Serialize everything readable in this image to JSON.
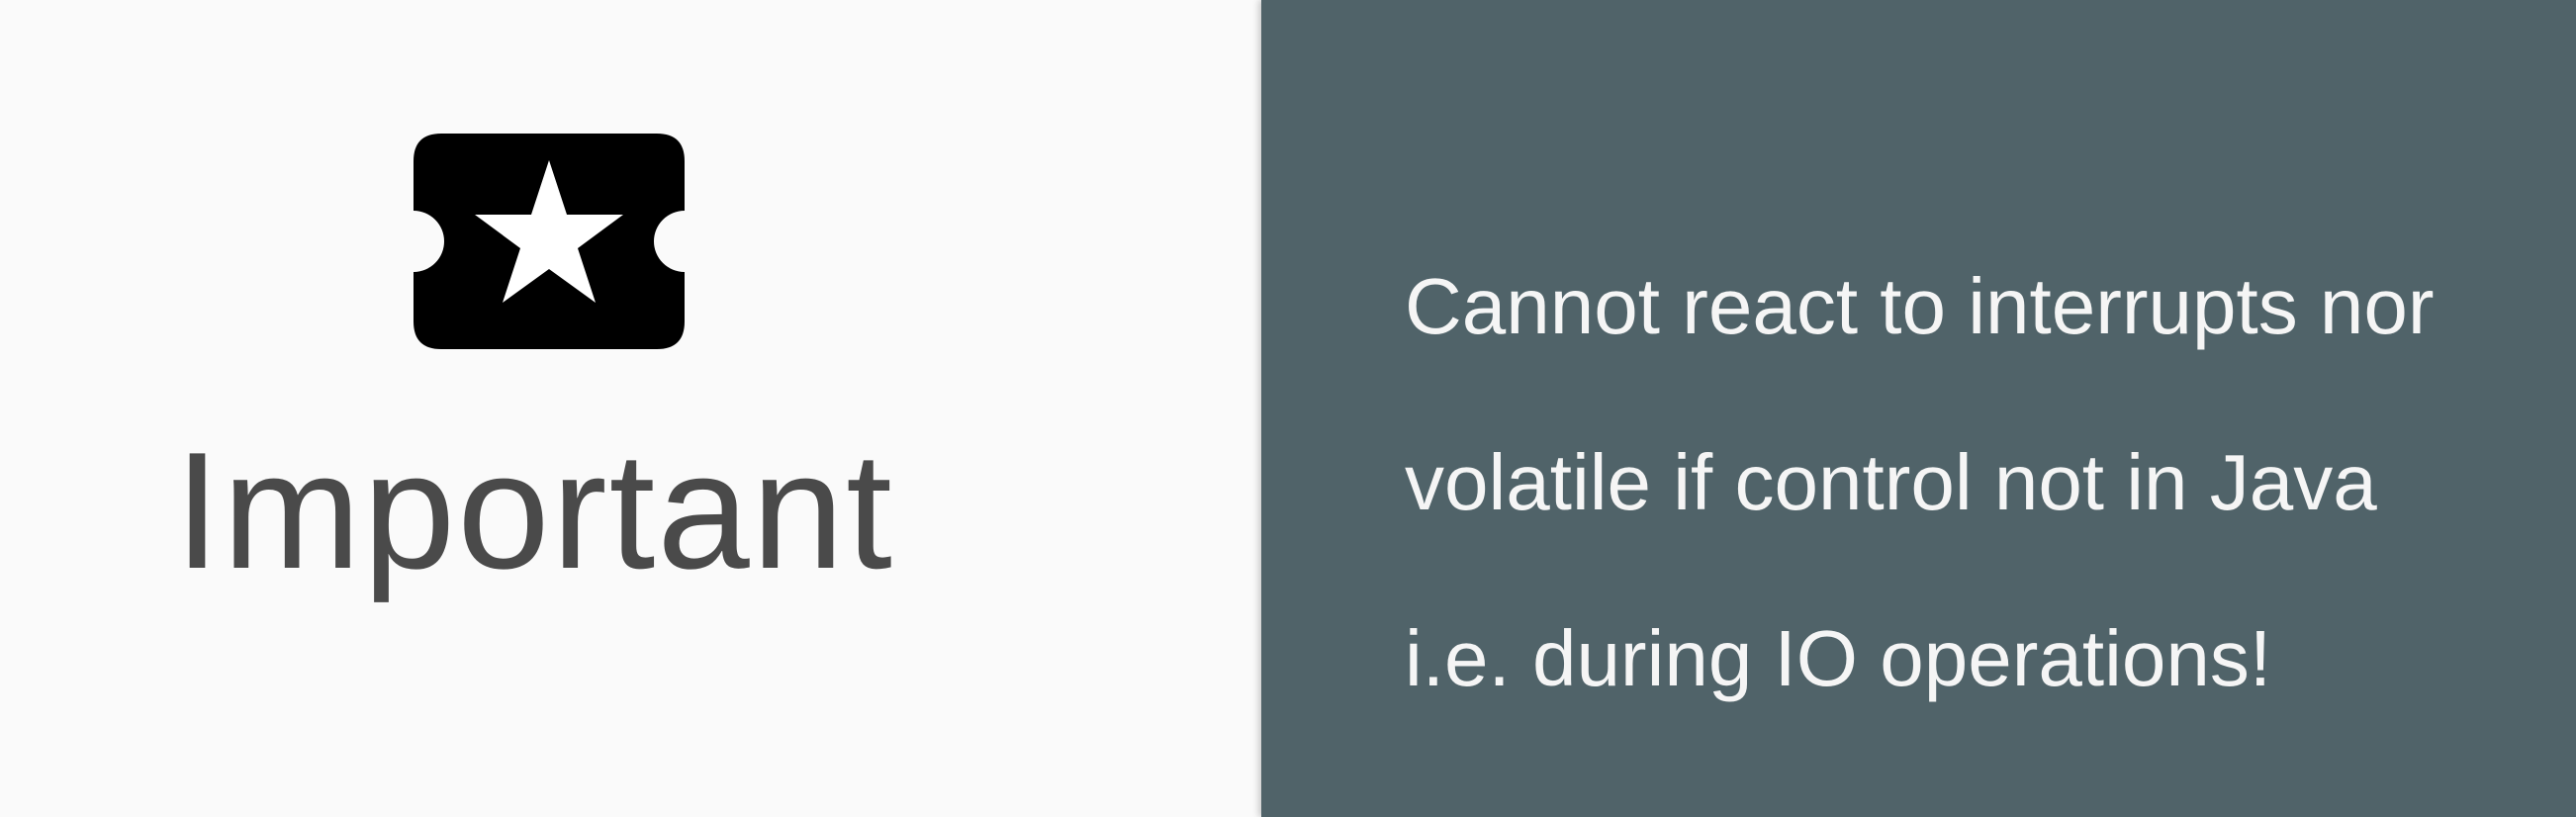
{
  "left": {
    "icon": "ticket-star-icon",
    "label": "Important"
  },
  "right": {
    "lines": [
      "Cannot react to interrupts nor",
      "volatile if control not in Java",
      "i.e. during IO operations!"
    ]
  },
  "colors": {
    "left_background": "#fafafa",
    "right_background": "#506369",
    "icon": "#000000",
    "label_text": "#4a4a4a",
    "message_text": "#f5f5f5"
  }
}
